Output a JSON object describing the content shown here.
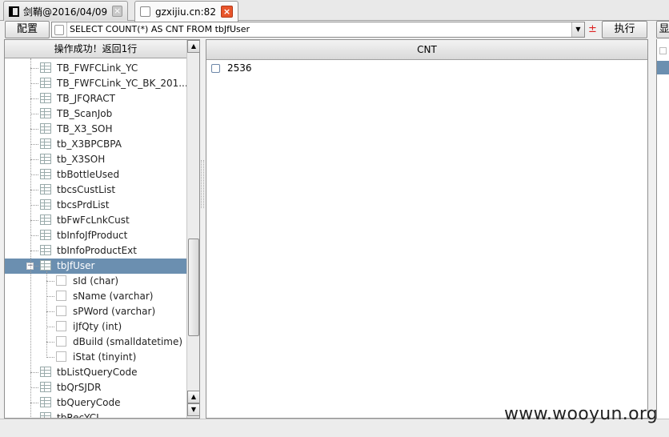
{
  "tabs": [
    {
      "label": "剑鞘@2016/04/09",
      "active": false,
      "close_icon": "close-grey-icon"
    },
    {
      "label": "gzxijiu.cn:82",
      "active": true,
      "close_icon": "close-red-icon"
    }
  ],
  "toolbar": {
    "config_label": "配置",
    "sql_text": "SELECT COUNT(*) AS CNT FROM tbJfUser",
    "plusminus": "±",
    "run_label": "执行"
  },
  "left_panel": {
    "status": "操作成功！返回1行",
    "tree_items": [
      {
        "label": "TB_FWFCLink_YC",
        "kind": "table"
      },
      {
        "label": "TB_FWFCLink_YC_BK_201...",
        "kind": "table"
      },
      {
        "label": "TB_JFQRACT",
        "kind": "table"
      },
      {
        "label": "TB_ScanJob",
        "kind": "table"
      },
      {
        "label": "TB_X3_SOH",
        "kind": "table"
      },
      {
        "label": "tb_X3BPCBPA",
        "kind": "table"
      },
      {
        "label": "tb_X3SOH",
        "kind": "table"
      },
      {
        "label": "tbBottleUsed",
        "kind": "table"
      },
      {
        "label": "tbcsCustList",
        "kind": "table"
      },
      {
        "label": "tbcsPrdList",
        "kind": "table"
      },
      {
        "label": "tbFwFcLnkCust",
        "kind": "table"
      },
      {
        "label": "tbInfoJfProduct",
        "kind": "table"
      },
      {
        "label": "tbInfoProductExt",
        "kind": "table"
      },
      {
        "label": "tbJfUser",
        "kind": "table",
        "selected": true,
        "expanded": true
      },
      {
        "label": "sId (char)",
        "kind": "column"
      },
      {
        "label": "sName (varchar)",
        "kind": "column"
      },
      {
        "label": "sPWord (varchar)",
        "kind": "column"
      },
      {
        "label": "iJfQty (int)",
        "kind": "column"
      },
      {
        "label": "dBuild (smalldatetime)",
        "kind": "column"
      },
      {
        "label": "iStat (tinyint)",
        "kind": "column"
      },
      {
        "label": "tbListQueryCode",
        "kind": "table"
      },
      {
        "label": "tbQrSJDR",
        "kind": "table"
      },
      {
        "label": "tbQueryCode",
        "kind": "table"
      },
      {
        "label": "tbRecYCL...",
        "kind": "table"
      }
    ]
  },
  "result": {
    "column": "CNT",
    "rows": [
      "2536"
    ]
  },
  "right_edge": {
    "partial_button_label": "显"
  },
  "watermark": "www.wooyun.org"
}
